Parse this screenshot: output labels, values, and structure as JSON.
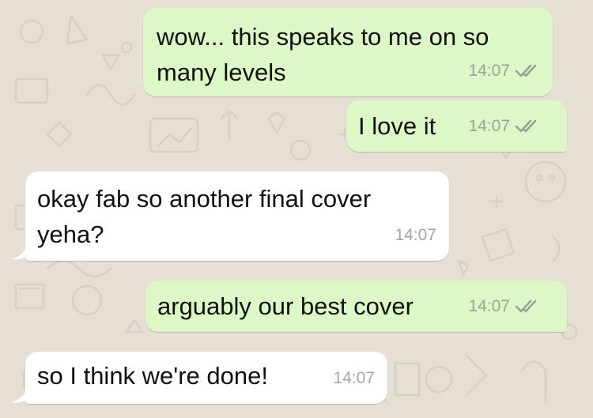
{
  "chat": {
    "messages": [
      {
        "direction": "outgoing",
        "text": "wow... this speaks to me on so\nmany levels",
        "time": "14:07",
        "status_icon": "double-check-icon"
      },
      {
        "direction": "outgoing",
        "text": "I love it",
        "time": "14:07",
        "status_icon": "double-check-icon"
      },
      {
        "direction": "incoming",
        "text": "okay fab so another final cover\nyeha?",
        "time": "14:07"
      },
      {
        "direction": "outgoing",
        "text": "arguably our best cover",
        "time": "14:07",
        "status_icon": "double-check-icon"
      },
      {
        "direction": "incoming",
        "text": "so I think we're done!",
        "time": "14:07"
      }
    ]
  },
  "colors": {
    "outgoing_bubble": "#dcf8c6",
    "incoming_bubble": "#ffffff",
    "wallpaper": "#e6dfd4",
    "read_ticks": "#93a096",
    "timestamp": "#9aa39a"
  }
}
